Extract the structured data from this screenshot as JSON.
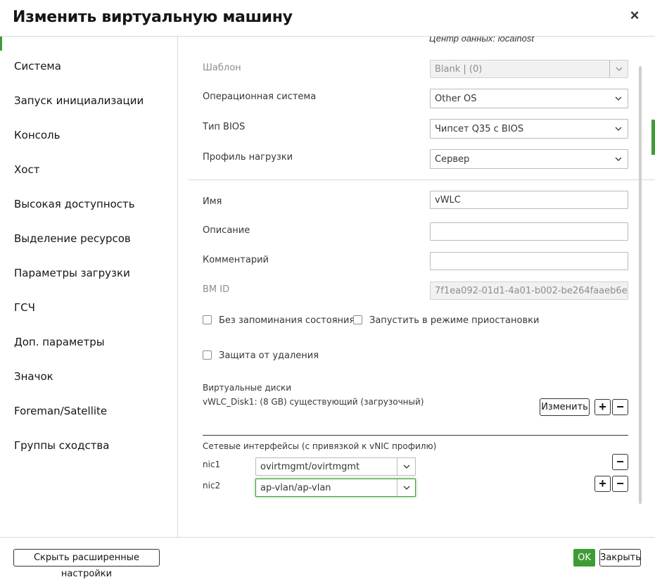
{
  "dialog": {
    "title": "Изменить виртуальную машину",
    "close_symbol": "×"
  },
  "sidebar": {
    "items": [
      {
        "label": "Система"
      },
      {
        "label": "Запуск инициализации"
      },
      {
        "label": "Консоль"
      },
      {
        "label": "Хост"
      },
      {
        "label": "Высокая доступность"
      },
      {
        "label": "Выделение ресурсов"
      },
      {
        "label": "Параметры загрузки"
      },
      {
        "label": "ГСЧ"
      },
      {
        "label": "Доп. параметры"
      },
      {
        "label": "Значок"
      },
      {
        "label": "Foreman/Satellite"
      },
      {
        "label": "Группы сходства"
      }
    ]
  },
  "general": {
    "datacenter": "Центр данных: localhost",
    "template": {
      "label": "Шаблон",
      "value": "Blank |  (0)"
    },
    "os": {
      "label": "Операционная система",
      "value": "Other OS"
    },
    "bios": {
      "label": "Тип BIOS",
      "value": "Чипсет Q35 с BIOS"
    },
    "profile": {
      "label": "Профиль нагрузки",
      "value": "Сервер"
    },
    "name": {
      "label": "Имя",
      "value": "vWLC"
    },
    "description": {
      "label": "Описание",
      "value": ""
    },
    "comment": {
      "label": "Комментарий",
      "value": ""
    },
    "vm_id": {
      "label": "ВМ ID",
      "value": "7f1ea092-01d1-4a01-b002-be264faaeb6e"
    },
    "stateless": {
      "label": "Без запоминания состояния",
      "checked": false
    },
    "start_paused": {
      "label": "Запустить в режиме приостановки",
      "checked": false
    },
    "delete_protection": {
      "label": "Защита от удаления",
      "checked": false
    }
  },
  "disks": {
    "title": "Виртуальные диски",
    "entry": "vWLC_Disk1: (8 GB) существующий (загрузочный)",
    "edit_label": "Изменить",
    "plus_symbol": "+",
    "minus_symbol": "−"
  },
  "network": {
    "title": "Сетевые интерфейсы (с привязкой к vNIC профилю)",
    "nics": [
      {
        "name": "nic1",
        "profile": "ovirtmgmt/ovirtmgmt"
      },
      {
        "name": "nic2",
        "profile": "ap-vlan/ap-vlan"
      }
    ],
    "plus_symbol": "+",
    "minus_symbol": "−"
  },
  "footer": {
    "advanced_label": "Скрыть расширенные настройки",
    "ok_label": "OK",
    "close_label": "Закрыть"
  },
  "colors": {
    "accent": "#3f9c35",
    "border": "#bbbbbb",
    "disabled_bg": "#f1f1f1"
  }
}
